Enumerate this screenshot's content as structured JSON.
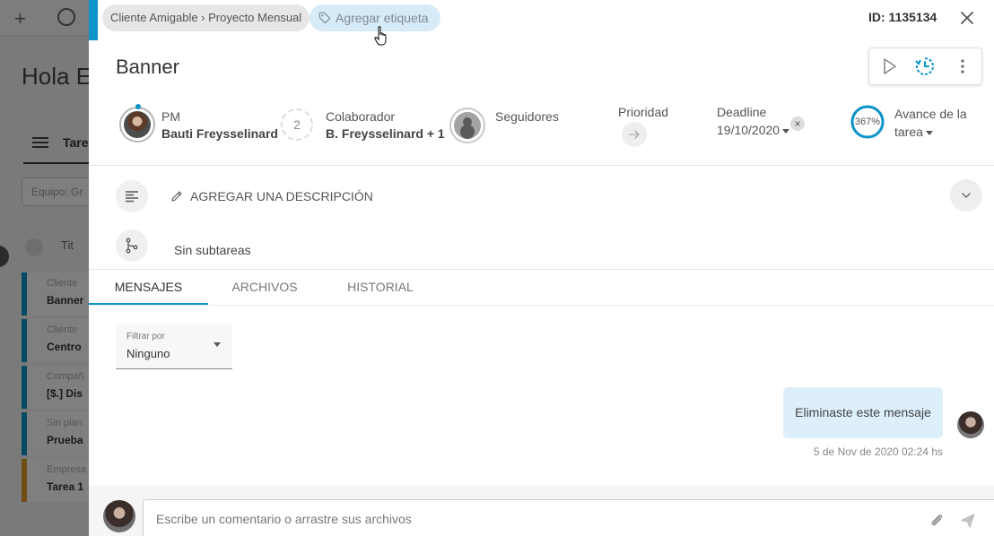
{
  "background": {
    "greeting": "Hola E",
    "tasks_tab": "Tare",
    "filter": "Equipo: Gr",
    "list_title": "Tit",
    "rows": [
      {
        "line1": "Cliente",
        "line2": "Banner"
      },
      {
        "line1": "Cliente",
        "line2": "Centro"
      },
      {
        "line1": "Compañ",
        "line2": "[$.] Dis"
      },
      {
        "line1": "Sin plan",
        "line2": "Prueba"
      },
      {
        "line1": "Empresa",
        "line2": "Tarea 1"
      }
    ]
  },
  "panel": {
    "breadcrumb": "Cliente Amigable › Proyecto Mensual",
    "add_tag_label": "Agregar etiqueta",
    "task_id": "ID: 1135134",
    "title": "Banner",
    "pm": {
      "role": "PM",
      "name": "Bauti Freysselinard"
    },
    "collaborators": {
      "count": "2",
      "role": "Colaborador",
      "names": "B. Freysselinard + 1"
    },
    "followers": {
      "label": "Seguidores"
    },
    "priority": {
      "label": "Prioridad"
    },
    "deadline": {
      "label": "Deadline",
      "date": "19/10/2020",
      "clear_glyph": "×"
    },
    "progress": {
      "percent": "367%",
      "label": "Avance de la tarea",
      "fraction": 1.0
    },
    "description": {
      "add_label": "AGREGAR UNA DESCRIPCIÓN"
    },
    "subtasks": {
      "empty_label": "Sin subtareas"
    },
    "tabs": [
      {
        "label": "MENSAJES",
        "active": true
      },
      {
        "label": "ARCHIVOS",
        "active": false
      },
      {
        "label": "HISTORIAL",
        "active": false
      }
    ],
    "filter": {
      "label": "Filtrar por",
      "value": "Ninguno"
    },
    "messages": [
      {
        "text": "Eliminaste este mensaje",
        "time": "5 de Nov de 2020 02:24 hs"
      }
    ],
    "composer": {
      "placeholder": "Escribe un comentario o arrastre sus archivos"
    }
  },
  "colors": {
    "accent": "#0a94c9",
    "bubble": "#ddeffa",
    "tag_bg": "#d6ebf7"
  }
}
